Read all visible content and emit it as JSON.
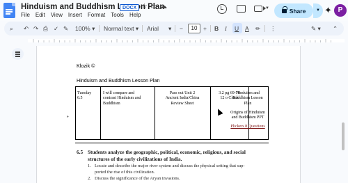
{
  "header": {
    "title": "Hinduism and Buddhism Lesson Plan",
    "badge": "DOCX",
    "star_icon": "star-icon",
    "folder_icon": "folder-icon",
    "cloud_icon": "cloud-icon",
    "menu": [
      "File",
      "Edit",
      "View",
      "Insert",
      "Format",
      "Tools",
      "Help"
    ],
    "share_label": "Share",
    "avatar_initial": "P"
  },
  "toolbar": {
    "zoom": "100%",
    "style": "Normal text",
    "font": "Arial",
    "font_size": "10",
    "bold": "B",
    "italic": "I",
    "underline": "U",
    "text_color": "A",
    "minus": "−",
    "plus": "+",
    "more": "⋮"
  },
  "document": {
    "author_line": "Klozik ©",
    "heading": "Hinduism and Buddhism Lesson Plan",
    "table": {
      "cells": [
        [
          "Tuesday",
          "6.5"
        ],
        [
          "I will compare and",
          "contrast Hinduism and",
          "Buddhism"
        ],
        [
          "Pass out Unit 2",
          "Ancient India/China",
          "Review Sheet"
        ],
        [
          "3.2 pg 69-74",
          "12 o Clock"
        ],
        [
          "Hinduism and",
          "Buddhism Lesson",
          "Plan",
          "",
          "Origins of Hinduism",
          "and Buddhism PPT",
          "",
          "Plickers 8 Questions"
        ]
      ]
    },
    "standard": {
      "number": "6.5",
      "title": "Students analyze the geographic, political, economic, religious, and social structures of the early civilizations of India.",
      "items": [
        {
          "n": "1.",
          "t1": "Locate and describe the major river system and discuss the physical setting that sup-",
          "t2": "ported the rise of this civilization."
        },
        {
          "n": "2.",
          "t1": "Discuss the significance of the Aryan invasions."
        }
      ]
    }
  },
  "colors": {
    "accent": "#0b57d0",
    "share_bg": "#c2e7ff",
    "avatar_bg": "#7b1fa2",
    "toolbar_bg": "#edf2fa"
  }
}
